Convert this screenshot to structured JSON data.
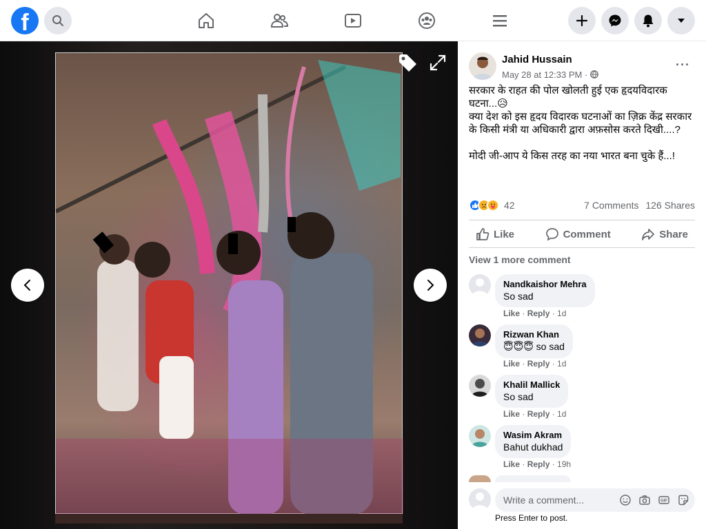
{
  "brand": {
    "logo_letter": "f",
    "color": "#1877f2"
  },
  "post": {
    "author": "Jahid Hussain",
    "time": "May 28 at 12:33 PM · ",
    "more": "···",
    "text": "सरकार के राहत की पोल खोलती हुई एक हृदयविदारक घटना...😥\nक्या देश को इस हृदय विदारक घटनाओं का ज़िक्र केंद्र सरकार के किसी मंत्री या अधिकारी द्वारा अफ़सोस करते दिखी....?\n\nमोदी जी-आप ये किस तरह का नया भारत बना चुके हैं...!",
    "reaction_count": "42",
    "comments_count": "7 Comments",
    "shares_count": "126 Shares"
  },
  "actions": {
    "like": "Like",
    "comment": "Comment",
    "share": "Share"
  },
  "view_more": "View 1 more comment",
  "comments": [
    {
      "name": "Nandkaishor Mehra",
      "text": "So sad",
      "like": "Like",
      "reply": "Reply",
      "age": "1d"
    },
    {
      "name": "Rizwan Khan",
      "text": "😇😇😇 so sad",
      "like": "Like",
      "reply": "Reply",
      "age": "1d"
    },
    {
      "name": "Khalil Mallick",
      "text": "So sad",
      "like": "Like",
      "reply": "Reply",
      "age": "1d"
    },
    {
      "name": "Wasim Akram",
      "text": "Bahut dukhad",
      "like": "Like",
      "reply": "Reply",
      "age": "19h"
    }
  ],
  "composer": {
    "placeholder": "Write a comment...",
    "hint": "Press Enter to post.",
    "gif": "GIF"
  }
}
